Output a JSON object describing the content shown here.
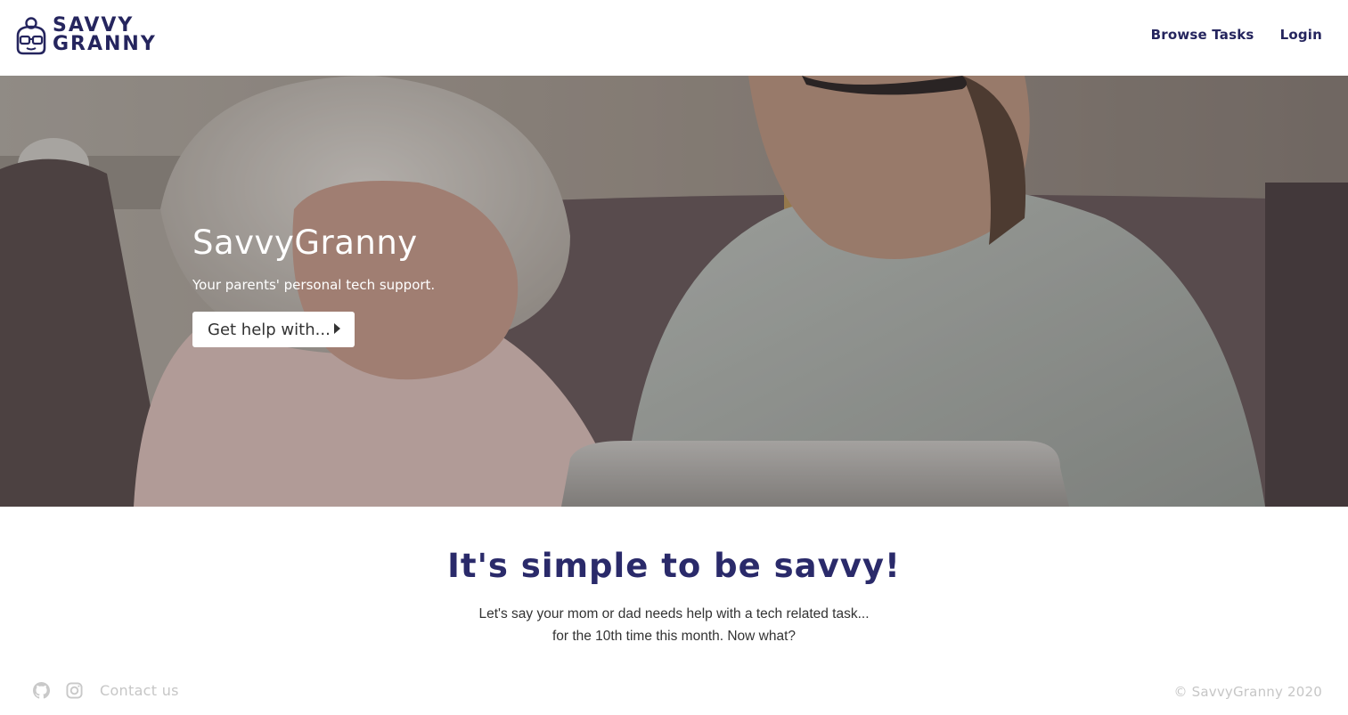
{
  "header": {
    "logo": {
      "line1": "SAVVY",
      "line2": "GRANNY",
      "icon": "granny-glasses-icon"
    },
    "nav": [
      {
        "label": "Browse Tasks"
      },
      {
        "label": "Login"
      }
    ]
  },
  "hero": {
    "title": "SavvyGranny",
    "subtitle": "Your parents' personal tech support.",
    "button_label": "Get help with...",
    "button_icon": "caret-right-icon"
  },
  "intro": {
    "heading": "It's simple to be savvy!",
    "line1": "Let's say your mom or dad needs help with a tech related task...",
    "line2": "for the 10th time this month. Now what?"
  },
  "footer": {
    "icons": [
      "github-icon",
      "instagram-icon"
    ],
    "contact_label": "Contact us",
    "copyright": "© SavvyGranny 2020"
  },
  "colors": {
    "brand_navy": "#25255e",
    "heading_navy": "#2a2a6a",
    "footer_gray": "#c6c6c6"
  }
}
